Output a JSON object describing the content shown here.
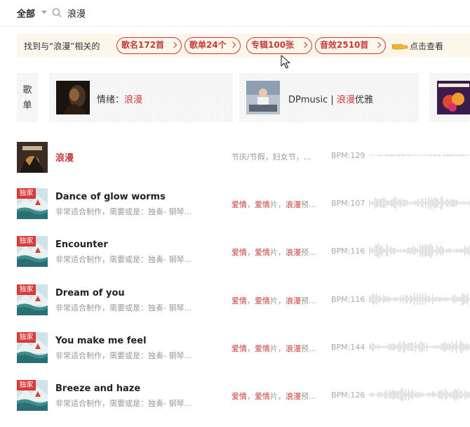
{
  "search": {
    "scope": "全部",
    "query": "浪漫"
  },
  "banner": {
    "prefix": "找到与“浪漫”相关的",
    "chips": [
      "歌名172首",
      "歌单24个",
      "专辑100张",
      "音效2510首"
    ],
    "view_label": "点击查看",
    "icon": "pointing-hand-icon"
  },
  "playlists": {
    "heading": "歌单",
    "cards": [
      {
        "prefix": "情绪：",
        "highlight": "浪漫",
        "suffix": ""
      },
      {
        "prefix": "DPmusic | ",
        "highlight": "浪漫",
        "suffix": "优雅"
      },
      {
        "prefix": "",
        "highlight": "",
        "suffix": ""
      }
    ]
  },
  "tracks": [
    {
      "name": "浪漫",
      "highlight_name": true,
      "exclusive": false,
      "desc": "",
      "tags": "节庆/节假，妇女节，...",
      "tags_hl": false,
      "bpm": "BPM:129"
    },
    {
      "name": "Dance of glow worms",
      "highlight_name": false,
      "exclusive": true,
      "exclusive_label": "独家",
      "desc": "非常适合制作，需要或是：独奏- 钢琴...",
      "tags": [
        "爱情",
        "，",
        "爱情",
        "片，",
        "浪漫",
        "预..."
      ],
      "tags_hl": true,
      "bpm": "BPM:107"
    },
    {
      "name": "Encounter",
      "highlight_name": false,
      "exclusive": true,
      "exclusive_label": "独家",
      "desc": "非常适合制作，需要或是：独奏- 钢琴...",
      "tags": [
        "爱情",
        "，",
        "爱情",
        "片，",
        "浪漫",
        "预..."
      ],
      "tags_hl": true,
      "bpm": "BPM:116"
    },
    {
      "name": "Dream of you",
      "highlight_name": false,
      "exclusive": true,
      "exclusive_label": "独家",
      "desc": "非常适合制作，需要或是：独奏- 钢琴...",
      "tags": [
        "爱情",
        "，",
        "爱情",
        "片，",
        "浪漫",
        "预..."
      ],
      "tags_hl": true,
      "bpm": "BPM:116"
    },
    {
      "name": "You make me feel",
      "highlight_name": false,
      "exclusive": true,
      "exclusive_label": "独家",
      "desc": "非常适合制作，需要或是：独奏- 钢琴...",
      "tags": [
        "爱情",
        "，",
        "爱情",
        "片，",
        "浪漫",
        "预..."
      ],
      "tags_hl": true,
      "bpm": "BPM:144"
    },
    {
      "name": "Breeze and haze",
      "highlight_name": false,
      "exclusive": true,
      "exclusive_label": "独家",
      "desc": "非常适合制作，需要或是：独奏- 钢琴...",
      "tags": [
        "爱情",
        "，",
        "爱情",
        "片，",
        "浪漫",
        "预..."
      ],
      "tags_hl": true,
      "bpm": "BPM:126"
    }
  ],
  "colors": {
    "accent": "#c73a3a",
    "banner_bg": "#fdf6ea",
    "exclusive_badge": "#d83a3a"
  }
}
